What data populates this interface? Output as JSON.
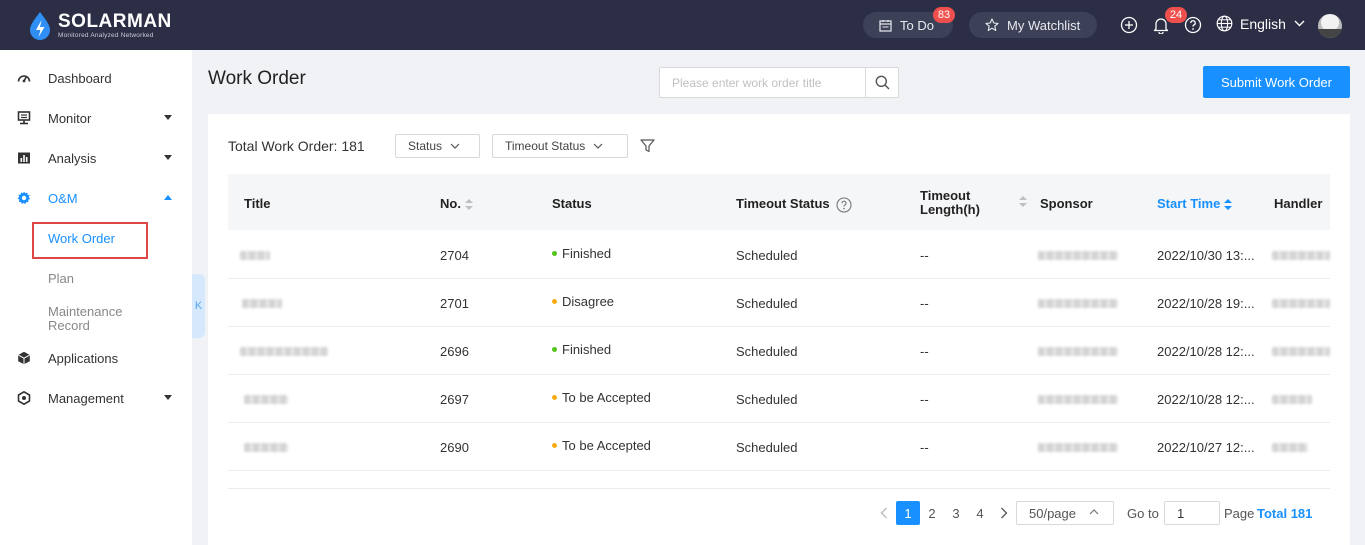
{
  "topbar": {
    "logo_name": "SOLARMAN",
    "logo_tagline": "Monitored Analyzed Networked",
    "todo_label": "To Do",
    "todo_badge": "83",
    "watchlist_label": "My Watchlist",
    "notify_badge": "24",
    "language": "English"
  },
  "sidebar": {
    "items": [
      {
        "label": "Dashboard",
        "icon": "gauge-icon"
      },
      {
        "label": "Monitor",
        "icon": "monitor-icon"
      },
      {
        "label": "Analysis",
        "icon": "bar-chart-icon"
      },
      {
        "label": "O&M",
        "icon": "gear-icon"
      },
      {
        "label": "Applications",
        "icon": "cube-icon"
      },
      {
        "label": "Management",
        "icon": "settings-icon"
      }
    ],
    "sub_items": [
      "Work Order",
      "Plan",
      "Maintenance Record"
    ],
    "collapse_glyph": "K"
  },
  "header": {
    "title": "Work Order",
    "search_placeholder": "Please enter work order title",
    "submit_label": "Submit Work Order"
  },
  "toolbar": {
    "total_label": "Total Work Order: 181",
    "status_filter": "Status",
    "timeout_filter": "Timeout Status"
  },
  "table": {
    "columns": {
      "title": "Title",
      "no": "No.",
      "status": "Status",
      "timeout_status": "Timeout Status",
      "timeout_length_1": "Timeout",
      "timeout_length_2": "Length(h)",
      "sponsor": "Sponsor",
      "start_time": "Start Time",
      "handler": "Handler"
    },
    "rows": [
      {
        "no": "2704",
        "status": "Finished",
        "status_color": "#52c41a",
        "timeout_status": "Scheduled",
        "timeout_length": "--",
        "start_time": "2022/10/30 13:..."
      },
      {
        "no": "2701",
        "status": "Disagree",
        "status_color": "#faad14",
        "timeout_status": "Scheduled",
        "timeout_length": "--",
        "start_time": "2022/10/28 19:..."
      },
      {
        "no": "2696",
        "status": "Finished",
        "status_color": "#52c41a",
        "timeout_status": "Scheduled",
        "timeout_length": "--",
        "start_time": "2022/10/28 12:..."
      },
      {
        "no": "2697",
        "status": "To be Accepted",
        "status_color": "#faad14",
        "timeout_status": "Scheduled",
        "timeout_length": "--",
        "start_time": "2022/10/28 12:..."
      },
      {
        "no": "2690",
        "status": "To be Accepted",
        "status_color": "#faad14",
        "timeout_status": "Scheduled",
        "timeout_length": "--",
        "start_time": "2022/10/27 12:..."
      }
    ]
  },
  "pagination": {
    "pages": [
      "1",
      "2",
      "3",
      "4"
    ],
    "current_page": "1",
    "page_size": "50/page",
    "goto_label": "Go to",
    "goto_value": "1",
    "page_label": "Page",
    "total_label": "Total 181"
  },
  "colors": {
    "topbar": "#2b2e44",
    "accent": "#1890ff",
    "badge": "#f0504d",
    "highlight": "#e04848"
  }
}
